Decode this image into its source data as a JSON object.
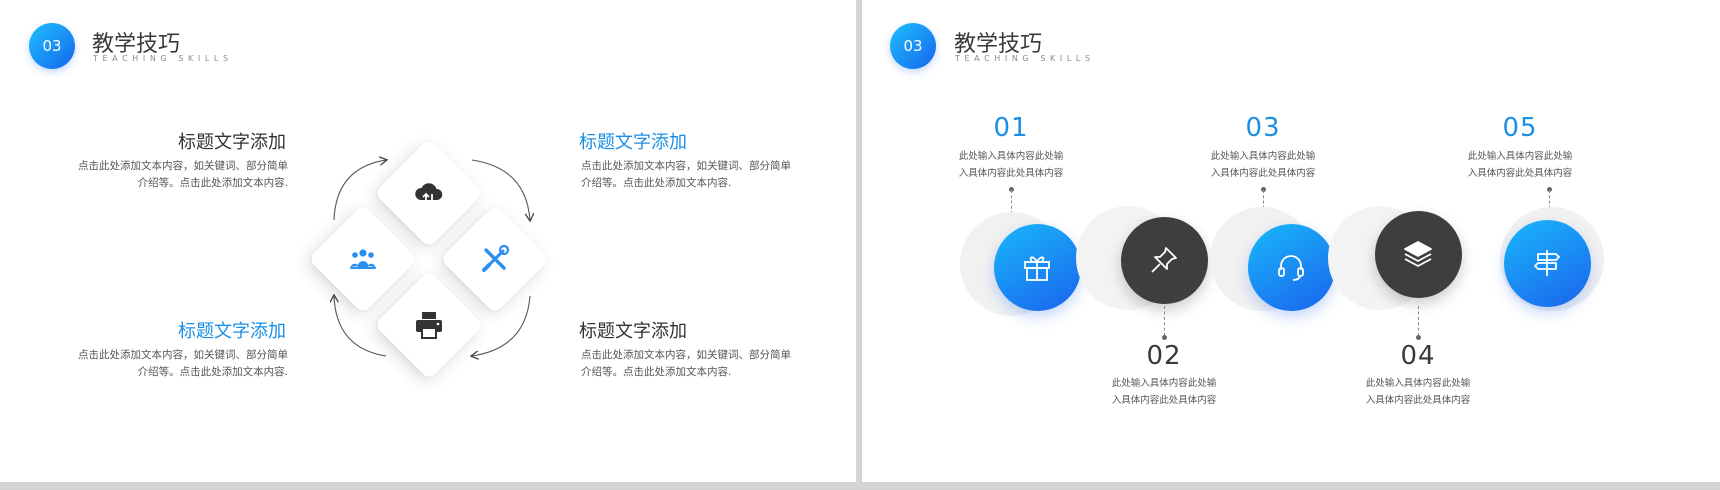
{
  "header": {
    "badge": "03",
    "title": "教学技巧",
    "subtitle": "TEACHING SKILLS"
  },
  "left_slide": {
    "blocks": [
      {
        "title": "标题文字添加",
        "line1": "点击此处添加文本内容，如关键词、部分简单",
        "line2": "介绍等。点击此处添加文本内容.",
        "title_color": "dark"
      },
      {
        "title": "标题文字添加",
        "line1": "点击此处添加文本内容，如关键词、部分简单",
        "line2": "介绍等。点击此处添加文本内容.",
        "title_color": "blue"
      },
      {
        "title": "标题文字添加",
        "line1": "点击此处添加文本内容，如关键词、部分简单",
        "line2": "介绍等。点击此处添加文本内容.",
        "title_color": "blue"
      },
      {
        "title": "标题文字添加",
        "line1": "点击此处添加文本内容，如关键词、部分简单",
        "line2": "介绍等。点击此处添加文本内容.",
        "title_color": "dark"
      }
    ],
    "diamond_icons": [
      "cloud-transfer-icon",
      "team-icon",
      "tools-icon",
      "printer-icon"
    ]
  },
  "right_slide": {
    "steps": [
      {
        "num": "01",
        "line1": "此处输入具体内容此处输",
        "line2": "入具体内容此处具体内容",
        "style": "blue",
        "icon": "gift-icon"
      },
      {
        "num": "02",
        "line1": "此处输入具体内容此处输",
        "line2": "入具体内容此处具体内容",
        "style": "dark",
        "icon": "pin-icon"
      },
      {
        "num": "03",
        "line1": "此处输入具体内容此处输",
        "line2": "入具体内容此处具体内容",
        "style": "blue",
        "icon": "headset-icon"
      },
      {
        "num": "04",
        "line1": "此处输入具体内容此处输",
        "line2": "入具体内容此处具体内容",
        "style": "dark",
        "icon": "layers-icon"
      },
      {
        "num": "05",
        "line1": "此处输入具体内容此处输",
        "line2": "入具体内容此处具体内容",
        "style": "blue",
        "icon": "signpost-icon"
      }
    ]
  },
  "colors": {
    "accent": "#1b8fe6",
    "gradient_start": "#1ec0ff",
    "gradient_end": "#1565ec",
    "dark": "#3e3e3e",
    "text": "#555555"
  }
}
